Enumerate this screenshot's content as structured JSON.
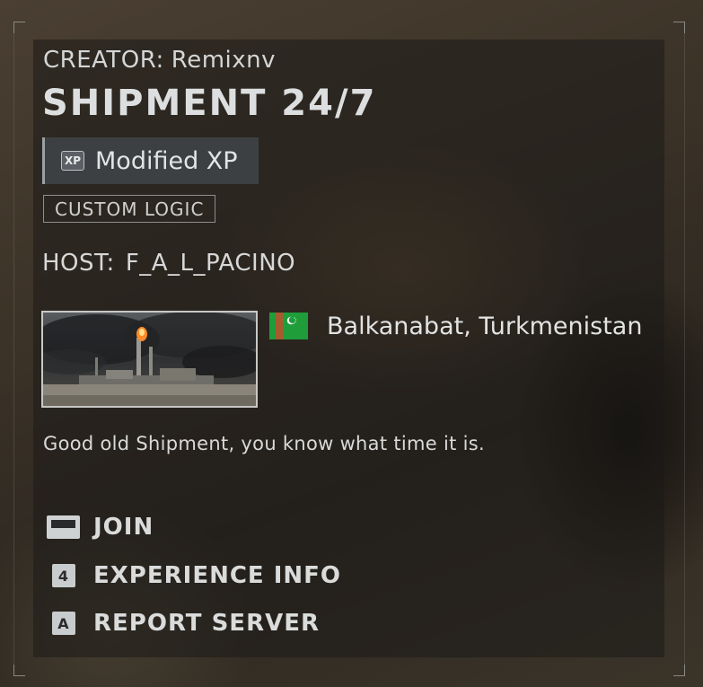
{
  "server": {
    "creator_label": "CREATOR:",
    "creator_name": "Remixnv",
    "title": "SHIPMENT 24/7",
    "xp_tag": "Modified XP",
    "xp_icon_text": "XP",
    "logic_tag": "CUSTOM LOGIC",
    "host_label": "HOST:",
    "host_name": "F_A_L_PACINO",
    "location": "Balkanabat, Turkmenistan",
    "flag_icon": "turkmenistan-flag-icon",
    "description": "Good old Shipment, you know what time it is."
  },
  "actions": [
    {
      "key_icon": "space-key-icon",
      "key": "",
      "label": "JOIN"
    },
    {
      "key_icon": "key-4-icon",
      "key": "4",
      "label": "EXPERIENCE INFO"
    },
    {
      "key_icon": "key-a-icon",
      "key": "A",
      "label": "REPORT SERVER"
    }
  ],
  "colors": {
    "panel_text": "#dfe0e0",
    "flag_green": "#1f9d3b",
    "tag_bg": "#3c4043"
  }
}
